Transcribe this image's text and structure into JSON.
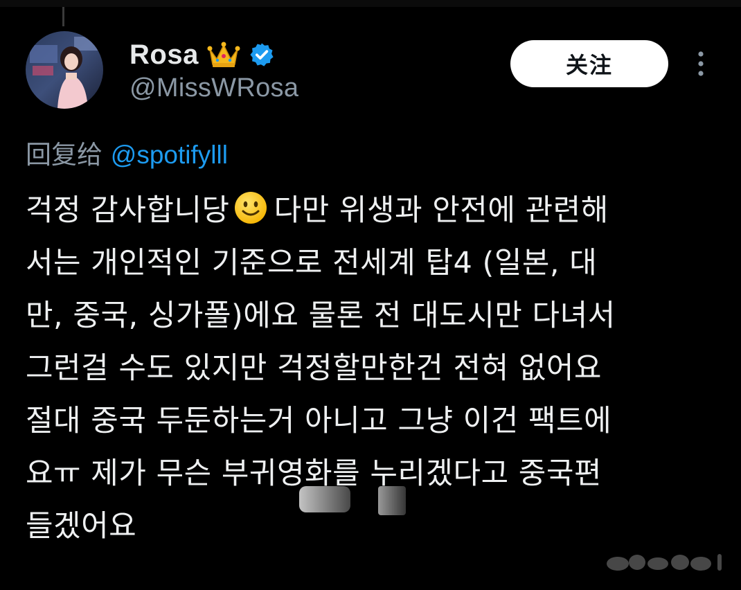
{
  "colors": {
    "background": "#000000",
    "text": "#eef0f1",
    "secondary": "#8b98a5",
    "link": "#1d9bf0",
    "verified": "#1d9bf0",
    "follow_bg": "#ffffff",
    "follow_text": "#0f1419"
  },
  "author": {
    "display_name": "Rosa",
    "handle": "@MissWRosa",
    "badge_icons": [
      "crown-icon",
      "verified-icon"
    ],
    "avatar_icon": "avatar"
  },
  "actions": {
    "follow_label": "关注",
    "more_icon": "more-icon"
  },
  "reply": {
    "prefix": "回复给 ",
    "target": "@spotifylll"
  },
  "tweet": {
    "lines": [
      {
        "before": "걱정 감사합니당",
        "emoji": "smile-icon",
        "after": " 다만 위생과 안전에 관련해"
      },
      {
        "text": "서는 개인적인 기준으로 전세계 탑4 (일본, 대"
      },
      {
        "text": "만, 중국, 싱가폴)에요  물론 전 대도시만 다녀서"
      },
      {
        "text": "그런걸 수도 있지만 걱정할만한건 전혀 없어요"
      },
      {
        "text": "절대 중국 두둔하는거 아니고 그냥 이건 팩트에"
      },
      {
        "text": "요ㅠ 제가 무슨 부귀영화를 누리겠다고 중국편"
      },
      {
        "text": "들겠어요"
      }
    ]
  }
}
